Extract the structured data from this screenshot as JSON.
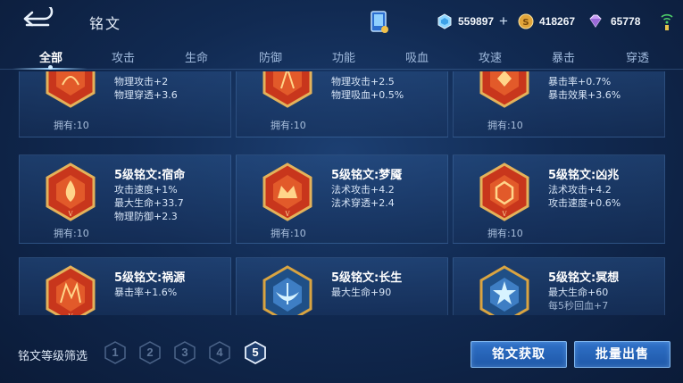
{
  "header": {
    "title": "铭文",
    "currencies": [
      {
        "icon": "diamond-icon",
        "value": "559897",
        "has_plus": true,
        "plus_label": "+"
      },
      {
        "icon": "gold-coin-icon",
        "value": "418267",
        "has_plus": false
      },
      {
        "icon": "gem-icon",
        "value": "65778",
        "has_plus": false
      }
    ]
  },
  "tabs": [
    "全部",
    "攻击",
    "生命",
    "防御",
    "功能",
    "吸血",
    "攻速",
    "暴击",
    "穿透"
  ],
  "active_tab": 0,
  "cards": [
    {
      "name": "",
      "attrs": [
        "物理攻击+2",
        "物理穿透+3.6"
      ],
      "owned": "拥有:10",
      "badge": "red"
    },
    {
      "name": "",
      "attrs": [
        "物理攻击+2.5",
        "物理吸血+0.5%"
      ],
      "owned": "拥有:10",
      "badge": "red"
    },
    {
      "name": "",
      "attrs": [
        "暴击率+0.7%",
        "暴击效果+3.6%"
      ],
      "owned": "拥有:10",
      "badge": "red"
    },
    {
      "name": "5级铭文:宿命",
      "attrs": [
        "攻击速度+1%",
        "最大生命+33.7",
        "物理防御+2.3"
      ],
      "owned": "拥有:10",
      "badge": "red"
    },
    {
      "name": "5级铭文:梦魇",
      "attrs": [
        "法术攻击+4.2",
        "法术穿透+2.4"
      ],
      "owned": "拥有:10",
      "badge": "red"
    },
    {
      "name": "5级铭文:凶兆",
      "attrs": [
        "法术攻击+4.2",
        "攻击速度+0.6%"
      ],
      "owned": "拥有:10",
      "badge": "red"
    },
    {
      "name": "5级铭文:祸源",
      "attrs": [
        "暴击率+1.6%"
      ],
      "owned": "",
      "badge": "red"
    },
    {
      "name": "5级铭文:长生",
      "attrs": [
        "最大生命+90"
      ],
      "owned": "",
      "badge": "blue"
    },
    {
      "name": "5级铭文:冥想",
      "attrs": [
        "最大生命+60",
        "每5秒回血+7"
      ],
      "owned": "",
      "badge": "blue"
    }
  ],
  "bottom": {
    "filter_label": "铭文等级筛选",
    "levels": [
      "1",
      "2",
      "3",
      "4",
      "5"
    ],
    "active_level": "5",
    "acquire_button": "铭文获取",
    "sell_button": "批量出售"
  },
  "colors": {
    "background": "#112a52",
    "button_blue": "#2f71c8",
    "badge_red": "#c8361c",
    "badge_gold": "#d9a441",
    "badge_blue": "#3e7ec4"
  }
}
